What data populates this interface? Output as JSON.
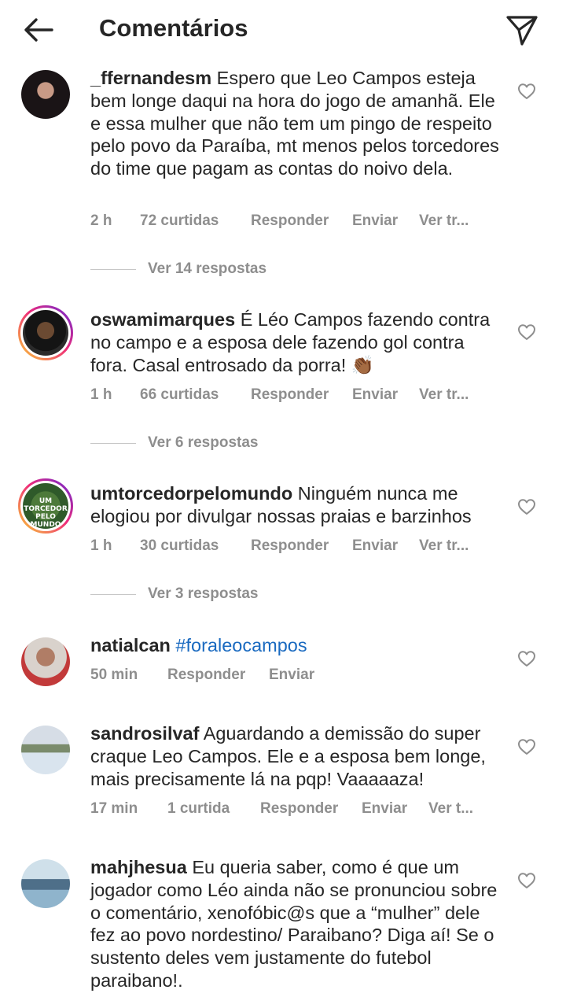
{
  "header": {
    "title": "Comentários",
    "back_icon": "arrow-left-icon",
    "send_icon": "paper-plane-icon"
  },
  "comments": [
    {
      "username": "_ffernandesm",
      "text": "Espero que Leo Campos esteja bem longe daqui na hora do jogo de amanhã. Ele e essa mulher que não tem um pingo de respeito pelo povo da Paraíba, mt menos pelos torcedores do time que pagam as contas do noivo dela.",
      "time": "2 h",
      "likes": "72 curtidas",
      "reply": "Responder",
      "send": "Enviar",
      "translate": "Ver tr...",
      "view_replies": "Ver 14 respostas"
    },
    {
      "username": "oswamimarques",
      "text": "É Léo Campos fazendo contra no campo e a esposa dele fazendo gol contra fora. Casal entrosado da porra! 👏🏾",
      "time": "1 h",
      "likes": "66 curtidas",
      "reply": "Responder",
      "send": "Enviar",
      "translate": "Ver tr...",
      "view_replies": "Ver 6 respostas"
    },
    {
      "username": "umtorcedorpelomundo",
      "text": "Ninguém nunca me elogiou por divulgar nossas praias e barzinhos",
      "avatar_text": "UM TORCEDOR PELO MUNDO",
      "time": "1 h",
      "likes": "30 curtidas",
      "reply": "Responder",
      "send": "Enviar",
      "translate": "Ver tr...",
      "view_replies": "Ver 3 respostas"
    },
    {
      "username": "natialcan",
      "text": "#foraleocampos",
      "time": "50 min",
      "reply": "Responder",
      "send": "Enviar"
    },
    {
      "username": "sandrosilvaf",
      "text": "Aguardando a demissão do super craque Leo Campos. Ele e a esposa bem longe, mais precisamente lá na pqp! Vaaaaaza!",
      "time": "17 min",
      "likes": "1 curtida",
      "reply": "Responder",
      "send": "Enviar",
      "translate": "Ver t..."
    },
    {
      "username": "mahjhesua",
      "text": "Eu queria saber, como é que um jogador como Léo ainda não se pronunciou sobre o comentário, xenofóbic@s que a “mulher” dele fez ao povo nordestino/ Paraibano? Diga aí! Se o sustento deles vem justamente do futebol paraibano!."
    }
  ],
  "icons": {
    "like": "heart-outline-icon"
  },
  "colors": {
    "text": "#262626",
    "muted": "#8e8e8e",
    "hashtag": "#1a6ac0",
    "story_ring_start": "#f9ce34",
    "story_ring_end": "#6228d7"
  }
}
